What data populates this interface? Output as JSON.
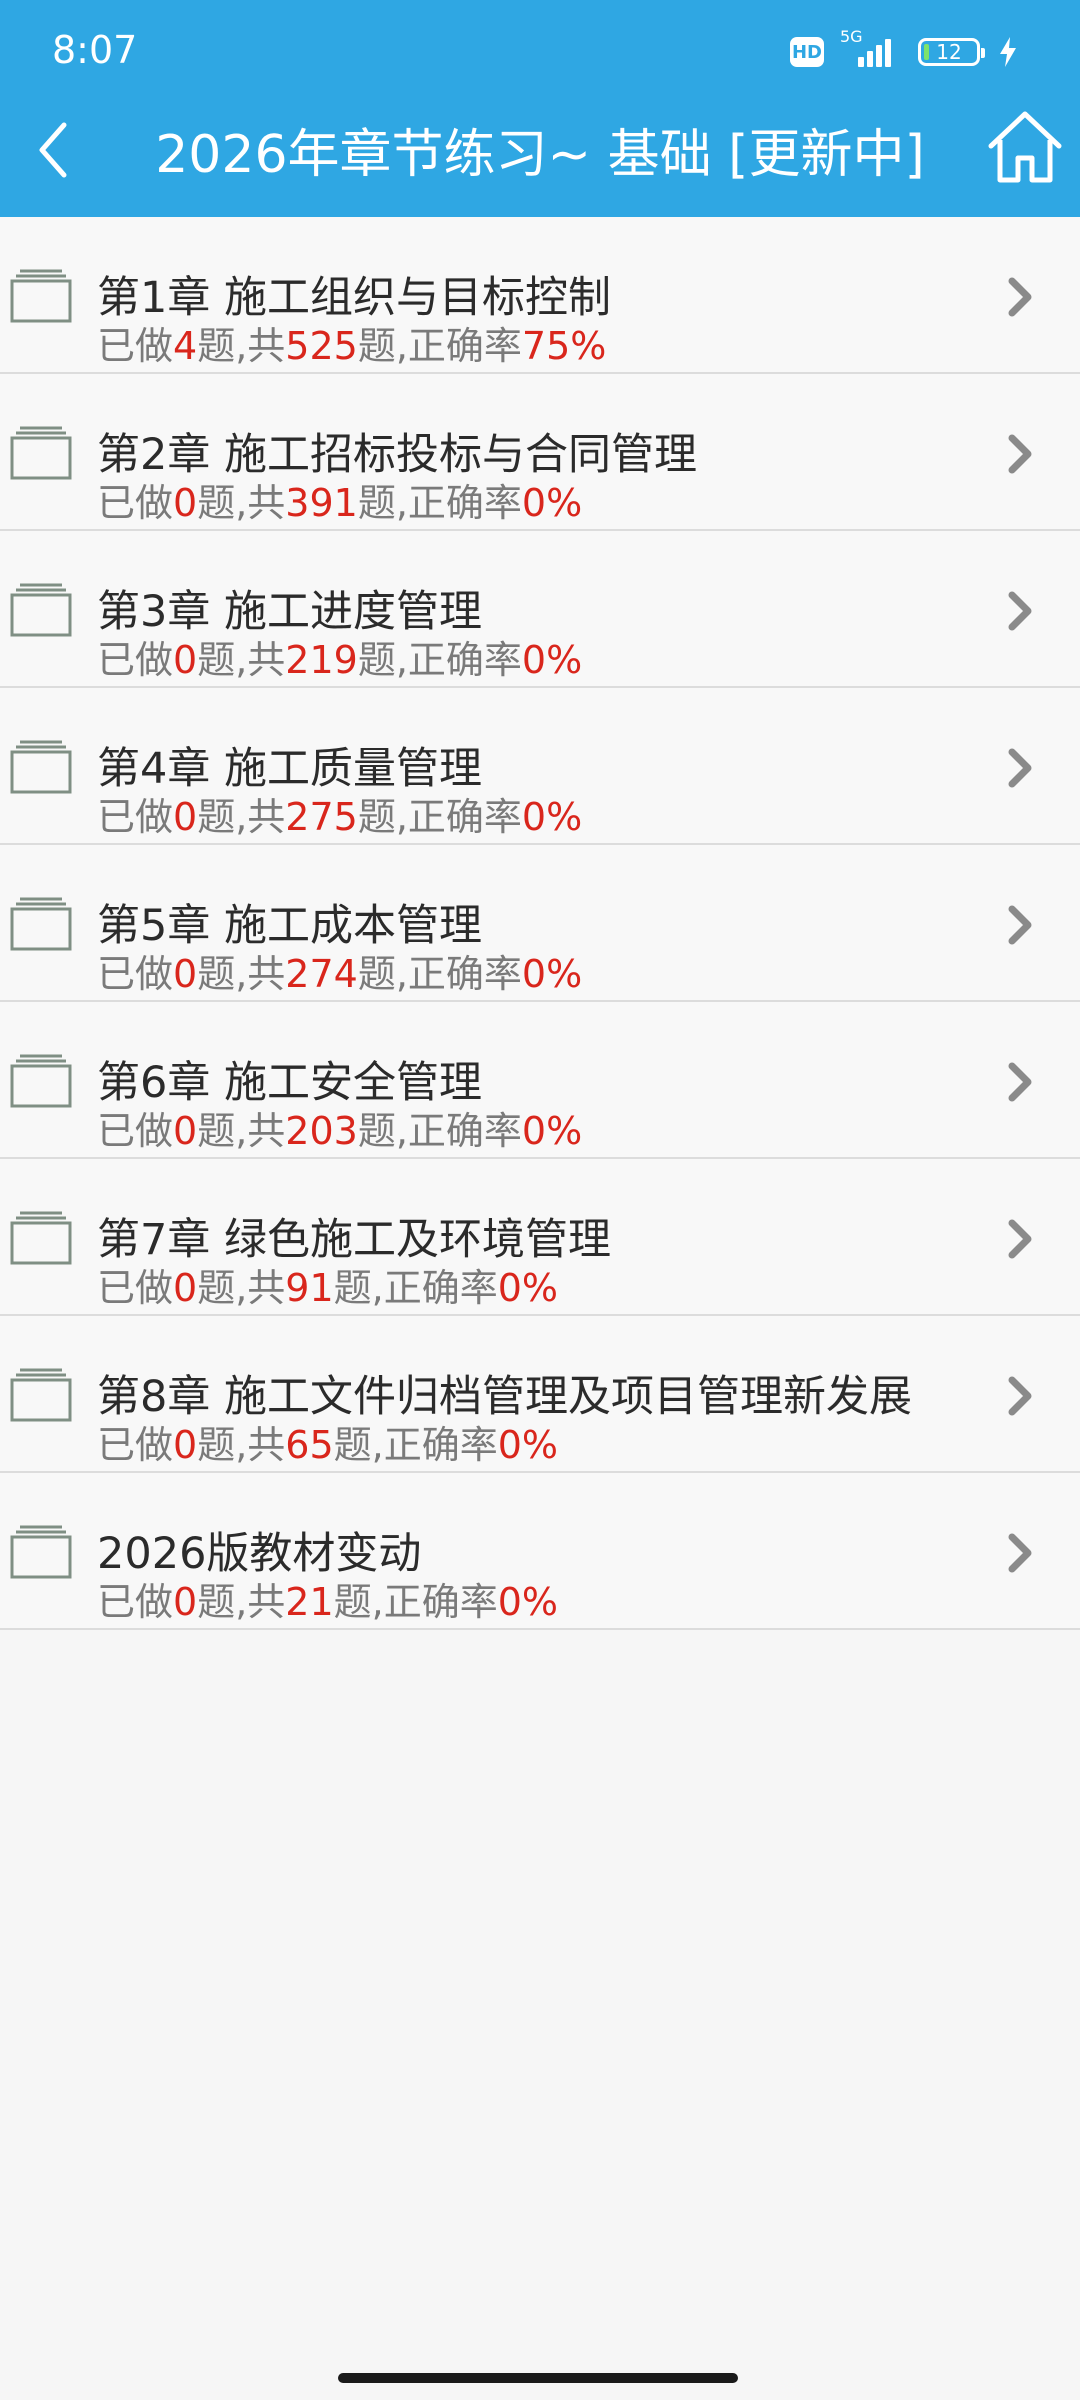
{
  "status_bar": {
    "time": "8:07",
    "hd": "HD",
    "network": "5G",
    "battery": "12"
  },
  "header": {
    "title": "2026年章节练习~ 基础 [更新中]",
    "back_icon": "chevron-left-icon",
    "home_icon": "home-icon"
  },
  "labels": {
    "done_prefix": "已做",
    "total_prefix": "题,共",
    "acc_prefix": "题,正确率"
  },
  "chapters": [
    {
      "title": "第1章 施工组织与目标控制",
      "done": "4",
      "total": "525",
      "accuracy": "75%"
    },
    {
      "title": "第2章 施工招标投标与合同管理",
      "done": "0",
      "total": "391",
      "accuracy": "0%"
    },
    {
      "title": "第3章 施工进度管理",
      "done": "0",
      "total": "219",
      "accuracy": "0%"
    },
    {
      "title": "第4章 施工质量管理",
      "done": "0",
      "total": "275",
      "accuracy": "0%"
    },
    {
      "title": "第5章 施工成本管理",
      "done": "0",
      "total": "274",
      "accuracy": "0%"
    },
    {
      "title": "第6章 施工安全管理",
      "done": "0",
      "total": "203",
      "accuracy": "0%"
    },
    {
      "title": "第7章 绿色施工及环境管理",
      "done": "0",
      "total": "91",
      "accuracy": "0%"
    },
    {
      "title": "第8章 施工文件归档管理及项目管理新发展",
      "done": "0",
      "total": "65",
      "accuracy": "0%"
    },
    {
      "title": "2026版教材变动",
      "done": "0",
      "total": "21",
      "accuracy": "0%"
    }
  ],
  "colors": {
    "header": "#2fa7e3",
    "accent_number": "#d9261c",
    "folder_icon": "#7f8f84"
  }
}
